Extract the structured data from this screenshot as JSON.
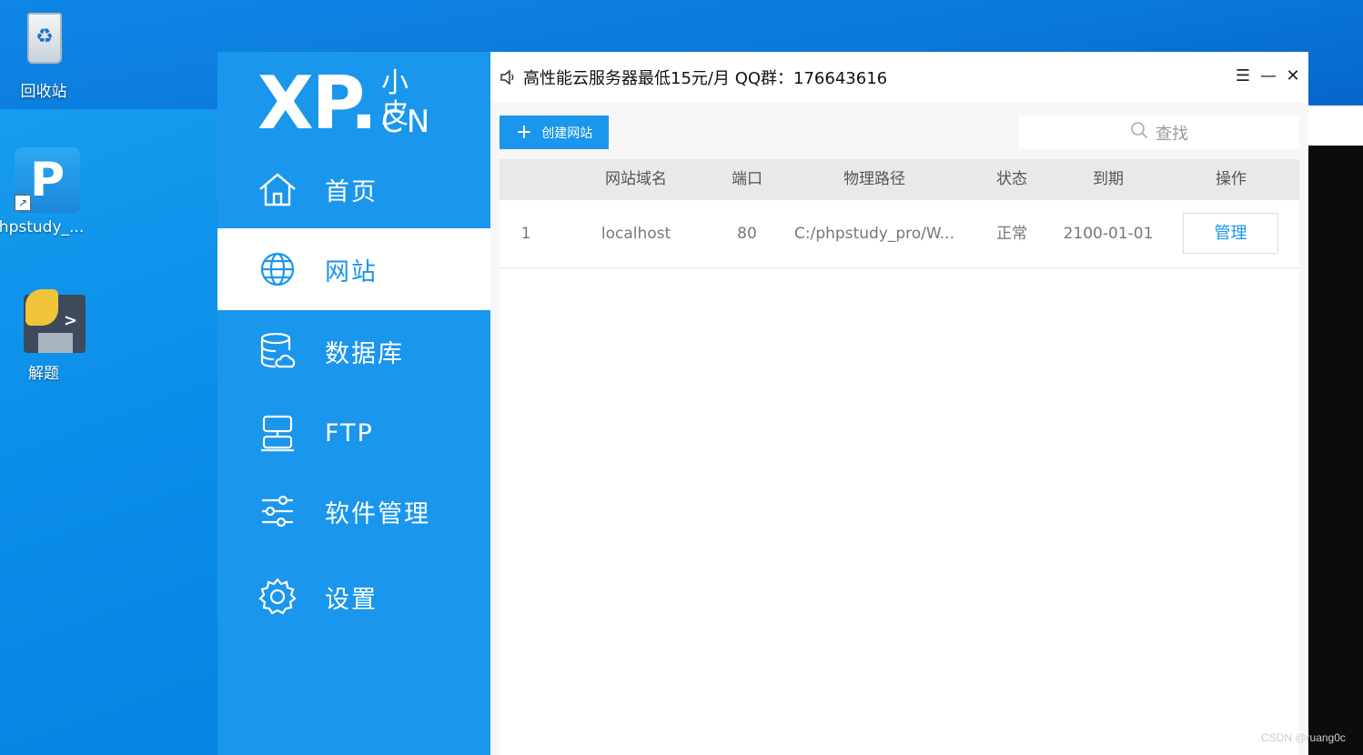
{
  "desktop": {
    "icons": [
      {
        "label": "回收站"
      },
      {
        "label": "phpstudy_..."
      },
      {
        "label": "解题"
      }
    ],
    "php_tile_letter": "P",
    "shortcut_glyph": "↗",
    "prompt_glyph": ">"
  },
  "sidebar": {
    "logo_main": "XP.",
    "logo_sub": "小皮",
    "logo_cn": "CN",
    "items": [
      {
        "label": "首页",
        "icon": "home-icon"
      },
      {
        "label": "网站",
        "icon": "globe-icon",
        "active": true
      },
      {
        "label": "数据库",
        "icon": "database-icon"
      },
      {
        "label": "FTP",
        "icon": "server-icon"
      },
      {
        "label": "软件管理",
        "icon": "sliders-icon"
      },
      {
        "label": "设置",
        "icon": "gear-icon"
      }
    ]
  },
  "titlebar": {
    "notice": "高性能云服务器最低15元/月  QQ群：176643616",
    "menu_glyph": "☰",
    "minimize_glyph": "—",
    "close_glyph": "✕"
  },
  "toolbar": {
    "create_label": "创建网站",
    "search_placeholder": "查找"
  },
  "table": {
    "columns": [
      "网站域名",
      "端口",
      "物理路径",
      "状态",
      "到期",
      "操作"
    ],
    "rows": [
      {
        "index": "1",
        "domain": "localhost",
        "port": "80",
        "path": "C:/phpstudy_pro/W...",
        "status": "正常",
        "expiry": "2100-01-01",
        "action": "管理"
      }
    ]
  },
  "colors": {
    "accent": "#1a96ec",
    "desktop": "#0a8de8"
  },
  "watermark": "CSDN @ruang0c"
}
